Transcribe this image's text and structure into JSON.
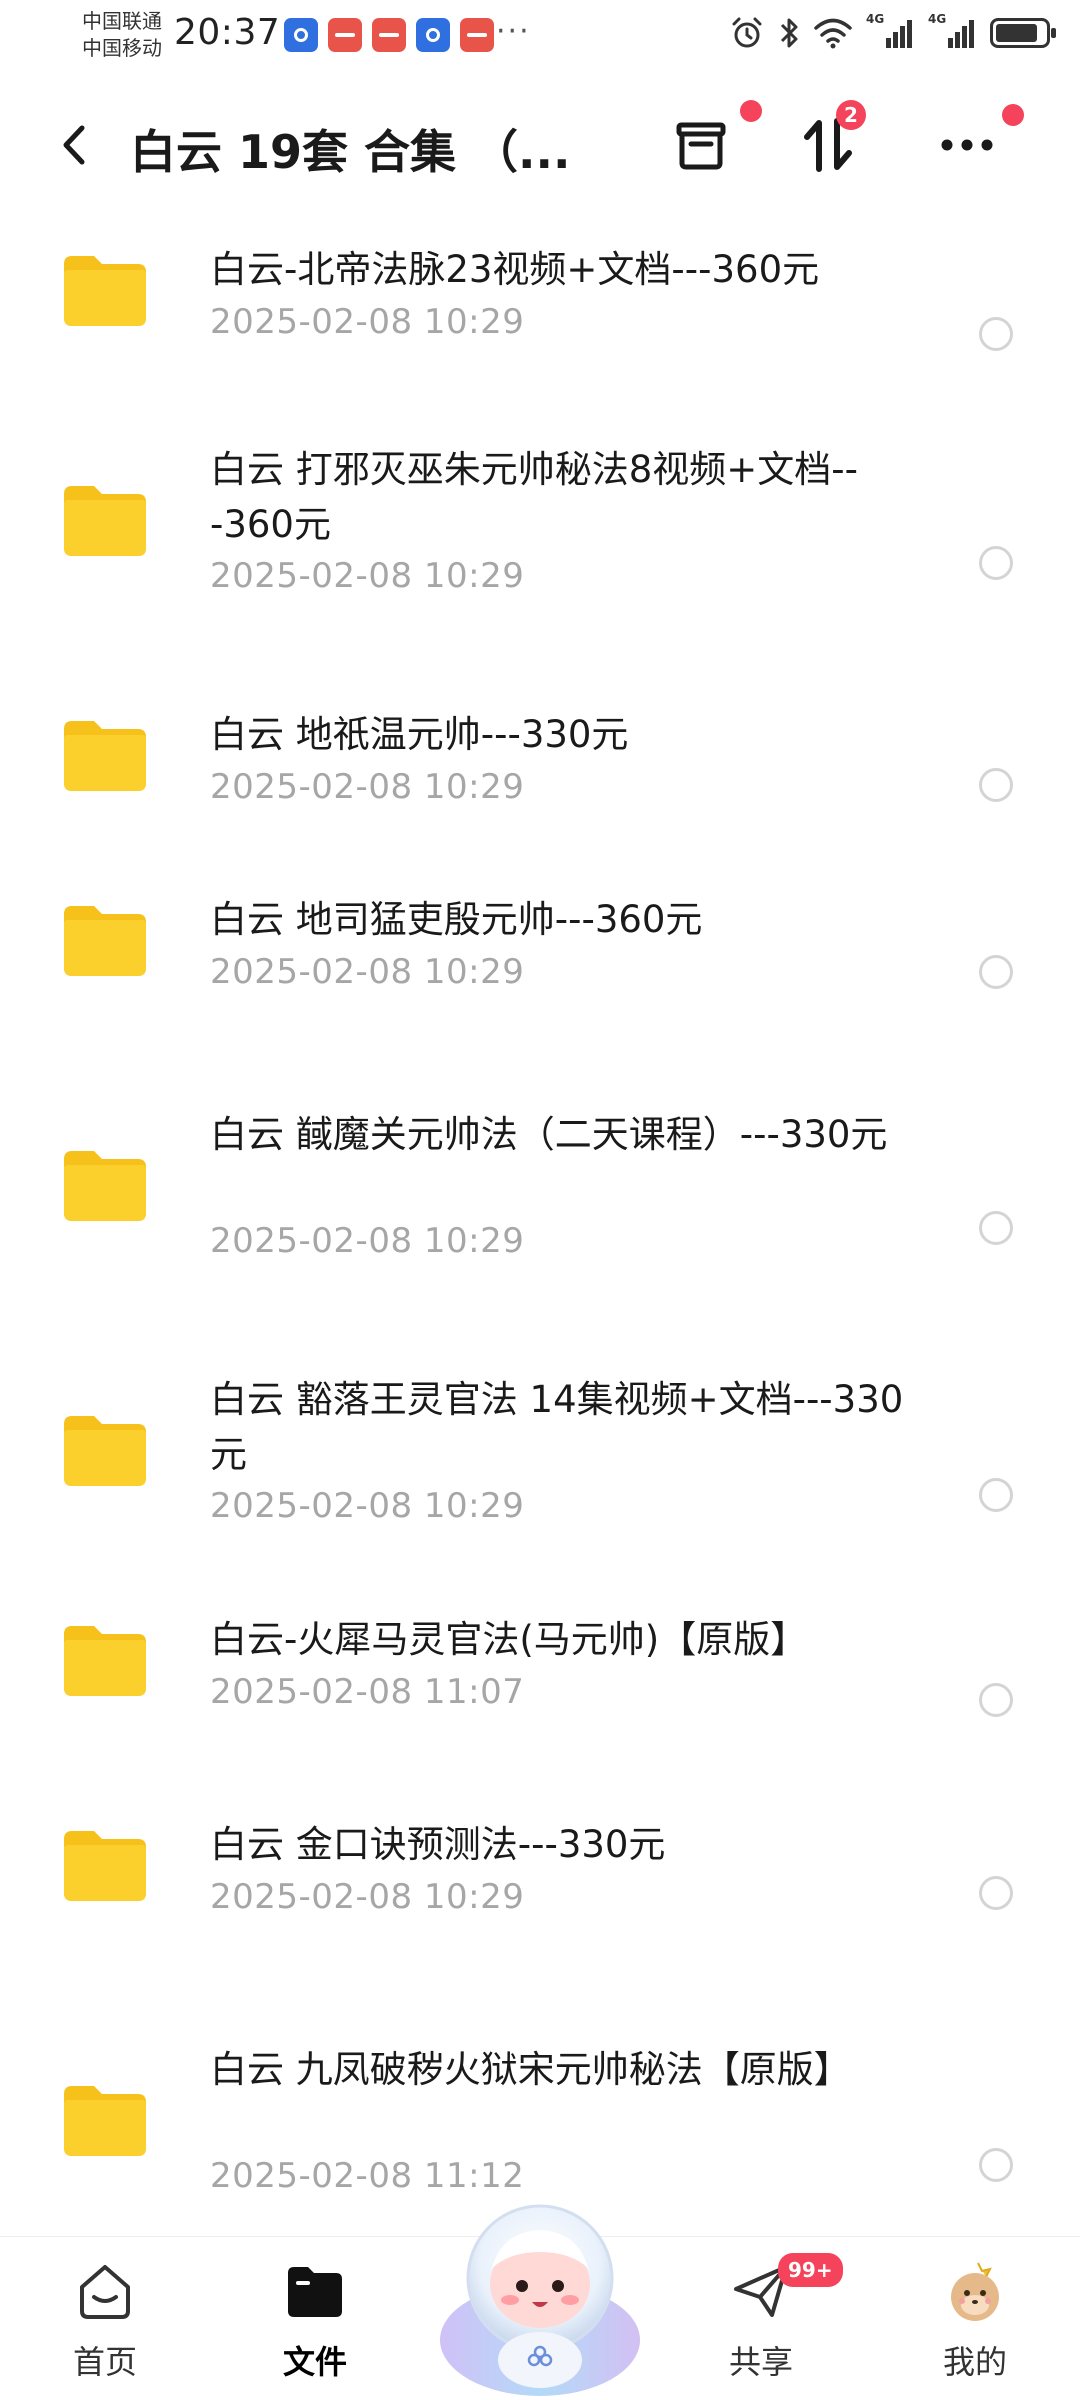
{
  "status_bar": {
    "carrier_1": "中国联通",
    "carrier_2": "中国移动",
    "time": "20:37",
    "more_indicator": "···",
    "network_1": "4G",
    "network_2": "4G",
    "battery_level": 0.85
  },
  "header": {
    "title": "白云 19套 合集 （...",
    "transfer_badge": "2"
  },
  "files": [
    {
      "name": "白云-北帝法脉23视频+文档---360元",
      "date": "2025-02-08  10:29"
    },
    {
      "name": "白云 打邪灭巫朱元帅秘法8视频+文档---360元",
      "date": "2025-02-08  10:29"
    },
    {
      "name": "白云 地祇温元帅---330元",
      "date": "2025-02-08  10:29"
    },
    {
      "name": "白云 地司猛吏殷元帅---360元",
      "date": "2025-02-08  10:29"
    },
    {
      "name": "白云 馘魔关元帅法（二天课程）---330元",
      "date": "2025-02-08  10:29"
    },
    {
      "name": "白云 豁落王灵官法 14集视频+文档---330元",
      "date": "2025-02-08  10:29"
    },
    {
      "name": "白云-火犀马灵官法(马元帅)【原版】",
      "date": "2025-02-08  11:07"
    },
    {
      "name": "白云 金口诀预测法---330元",
      "date": "2025-02-08  10:29"
    },
    {
      "name": "白云 九凤破秽火狱宋元帅秘法【原版】",
      "date": "2025-02-08  11:12"
    }
  ],
  "bottom_nav": {
    "home": "首页",
    "files": "文件",
    "share": "共享",
    "share_badge": "99+",
    "mine": "我的"
  },
  "colors": {
    "folder": "#fcd02c",
    "folder_tab": "#f5c11a",
    "badge": "#f4435a",
    "date": "#a6a6a6"
  }
}
